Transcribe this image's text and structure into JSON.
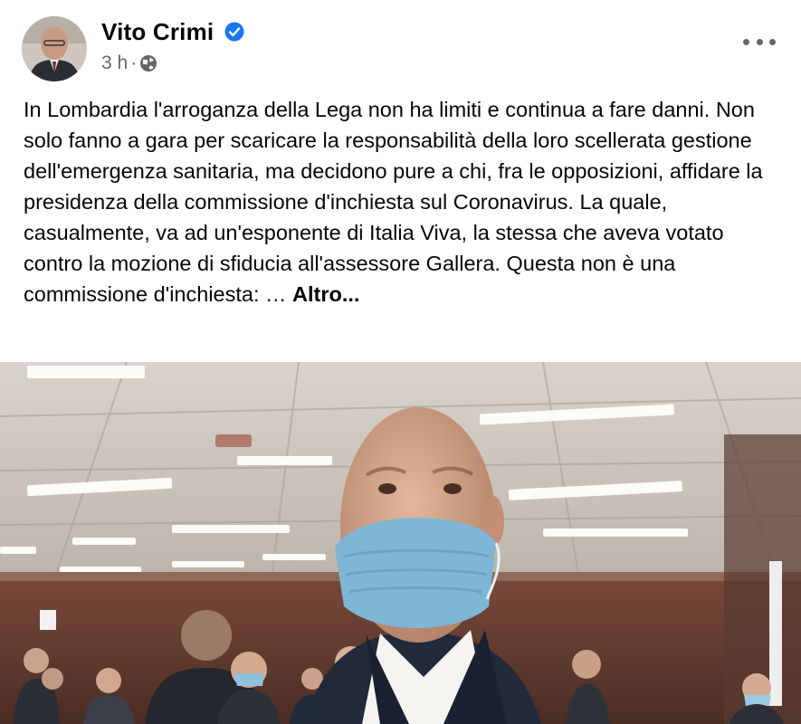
{
  "post": {
    "author": "Vito Crimi",
    "verified": true,
    "time": "3 h",
    "separator": "·",
    "audience_icon": "globe-icon",
    "body_text": "In Lombardia l'arroganza della Lega non ha limiti e continua a fare danni. Non solo fanno a gara per scaricare la responsabilità della loro scellerata gestione dell'emergenza sanitaria, ma decidono pure a chi, fra le opposizioni, affidare la presidenza della commissione d'inchiesta sul Coronavirus. La quale, casualmente, va ad un'esponente di Italia Viva, la stessa che aveva votato contro la mozione di sfiducia all'assessore Gallera. Questa non è una commissione d'inchiesta: …",
    "see_more_label": "Altro...",
    "more_icon": "more-horizontal-icon"
  },
  "colors": {
    "text": "#050505",
    "meta": "#65676b",
    "verified_badge": "#1877f2",
    "mask": "#7fb6d6"
  }
}
